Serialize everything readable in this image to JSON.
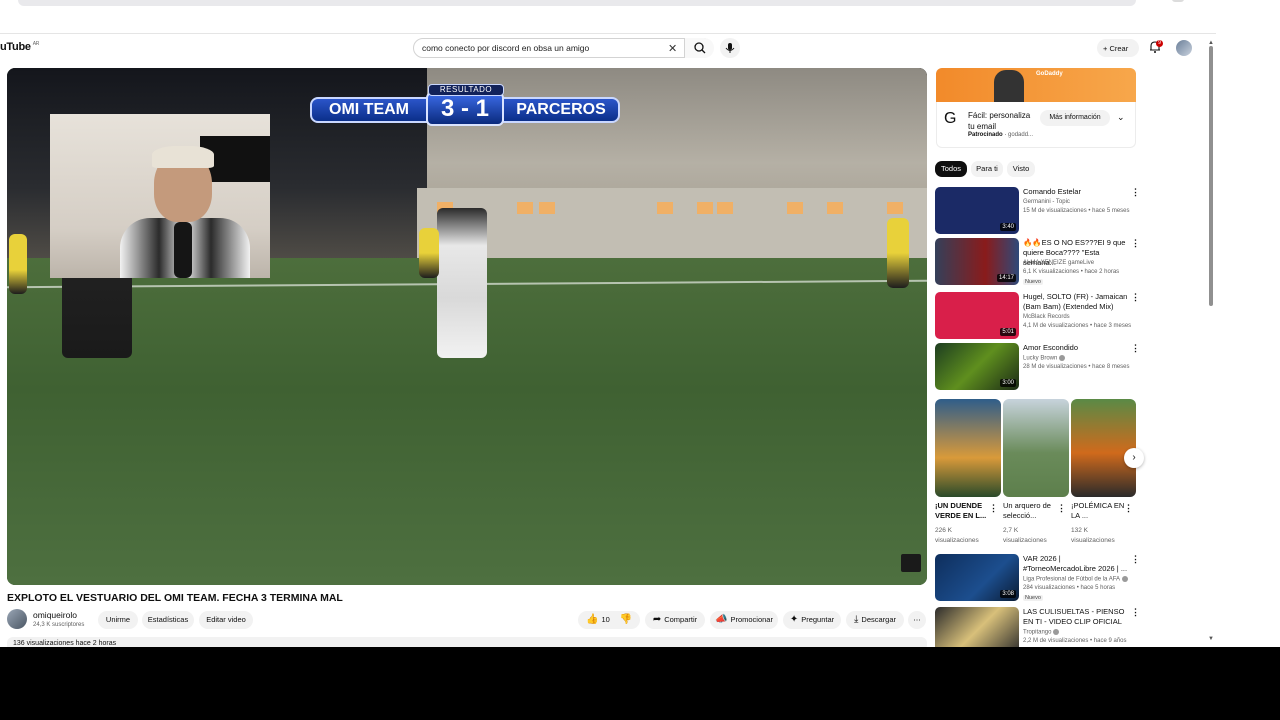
{
  "masthead": {
    "logo": "uTube",
    "region": "AR",
    "search_value": "como conecto por discord en obsa un amigo",
    "create_label": "Crear",
    "notification_count": "9"
  },
  "video": {
    "scoreboard": {
      "tag": "RESULTADO",
      "home": "OMI TEAM",
      "score": "3 - 1",
      "away": "PARCEROS"
    },
    "title": "EXPLOTO EL VESTUARIO DEL OMI TEAM. FECHA 3 TERMINA MAL",
    "channel": "omiqueirolo",
    "subscribers": "24,3 K suscriptores",
    "buttons": {
      "join": "Unirme",
      "stats": "Estadísticas",
      "edit": "Editar video",
      "likes": "10",
      "share": "Compartir",
      "promote": "Promocionar",
      "ask": "Preguntar",
      "download": "Descargar"
    },
    "description_preview": "136 visualizaciones  hace 2 horas"
  },
  "ad": {
    "brand": "GoDaddy",
    "title": "Fácil: personaliza tu email",
    "sponsored": "Patrocinado",
    "domain": "godadd...",
    "cta": "Más información"
  },
  "chips": [
    "Todos",
    "Para ti",
    "Visto"
  ],
  "recommendations": [
    {
      "title": "Comando Estelar",
      "channel": "Germanini - Topic",
      "meta": "15 M de visualizaciones • hace 5 meses",
      "duration": "3:40",
      "new": "",
      "verified": false,
      "thumb": "#1b2a66"
    },
    {
      "title": "🔥🔥ES O NO ES???EI 9 que quiere Boca???? \"Esta semana...",
      "channel": "ALMA XENEIZE gameLive",
      "meta": "6,1 K visualizaciones • hace 2 horas",
      "duration": "14:17",
      "new": "Nuevo",
      "verified": false,
      "thumb": "#34405a"
    },
    {
      "title": "Hugel, SOLTO (FR) - Jamaican (Bam Bam) (Extended Mix)",
      "channel": "McBlack Records",
      "meta": "4,1 M de visualizaciones • hace 3 meses",
      "duration": "5:01",
      "new": "",
      "verified": false,
      "thumb": "#d91f4a"
    },
    {
      "title": "Amor Escondido",
      "channel": "Lucky Brown",
      "meta": "28 M de visualizaciones • hace 8 meses",
      "duration": "3:00",
      "new": "",
      "verified": true,
      "thumb": "#1d3d20"
    },
    {
      "title": "VAR 2026 | #TorneoMercadoLibre 2026 | ...",
      "channel": "Liga Profesional de Fútbol de la AFA",
      "meta": "284 visualizaciones • hace 5 horas",
      "duration": "3:08",
      "new": "Nuevo",
      "verified": true,
      "thumb": "#0e2e5c"
    },
    {
      "title": "LAS CULISUELTAS - PIENSO EN TI - VIDEO CLIP OFICIAL",
      "channel": "Tropitango",
      "meta": "2,2 M de visualizaciones • hace 9 años",
      "duration": "",
      "new": "",
      "verified": true,
      "thumb": "#2b2b2b"
    }
  ],
  "shorts": [
    {
      "title": "¡UN DUENDE VERDE EN L...",
      "views": "226 K visualizaciones",
      "thumb": "#2f5d8a"
    },
    {
      "title": "Un arquero de selecció...",
      "views": "2,7 K visualizaciones",
      "thumb": "#6a8b5a"
    },
    {
      "title": "¡POLÉMICA EN LA ...",
      "views": "132 K visualizaciones",
      "thumb": "#d06a1c"
    }
  ],
  "colors": {
    "accent": "#0f0f0f",
    "brand_red": "#ff0000",
    "ad_orange": "#f28a2a"
  }
}
